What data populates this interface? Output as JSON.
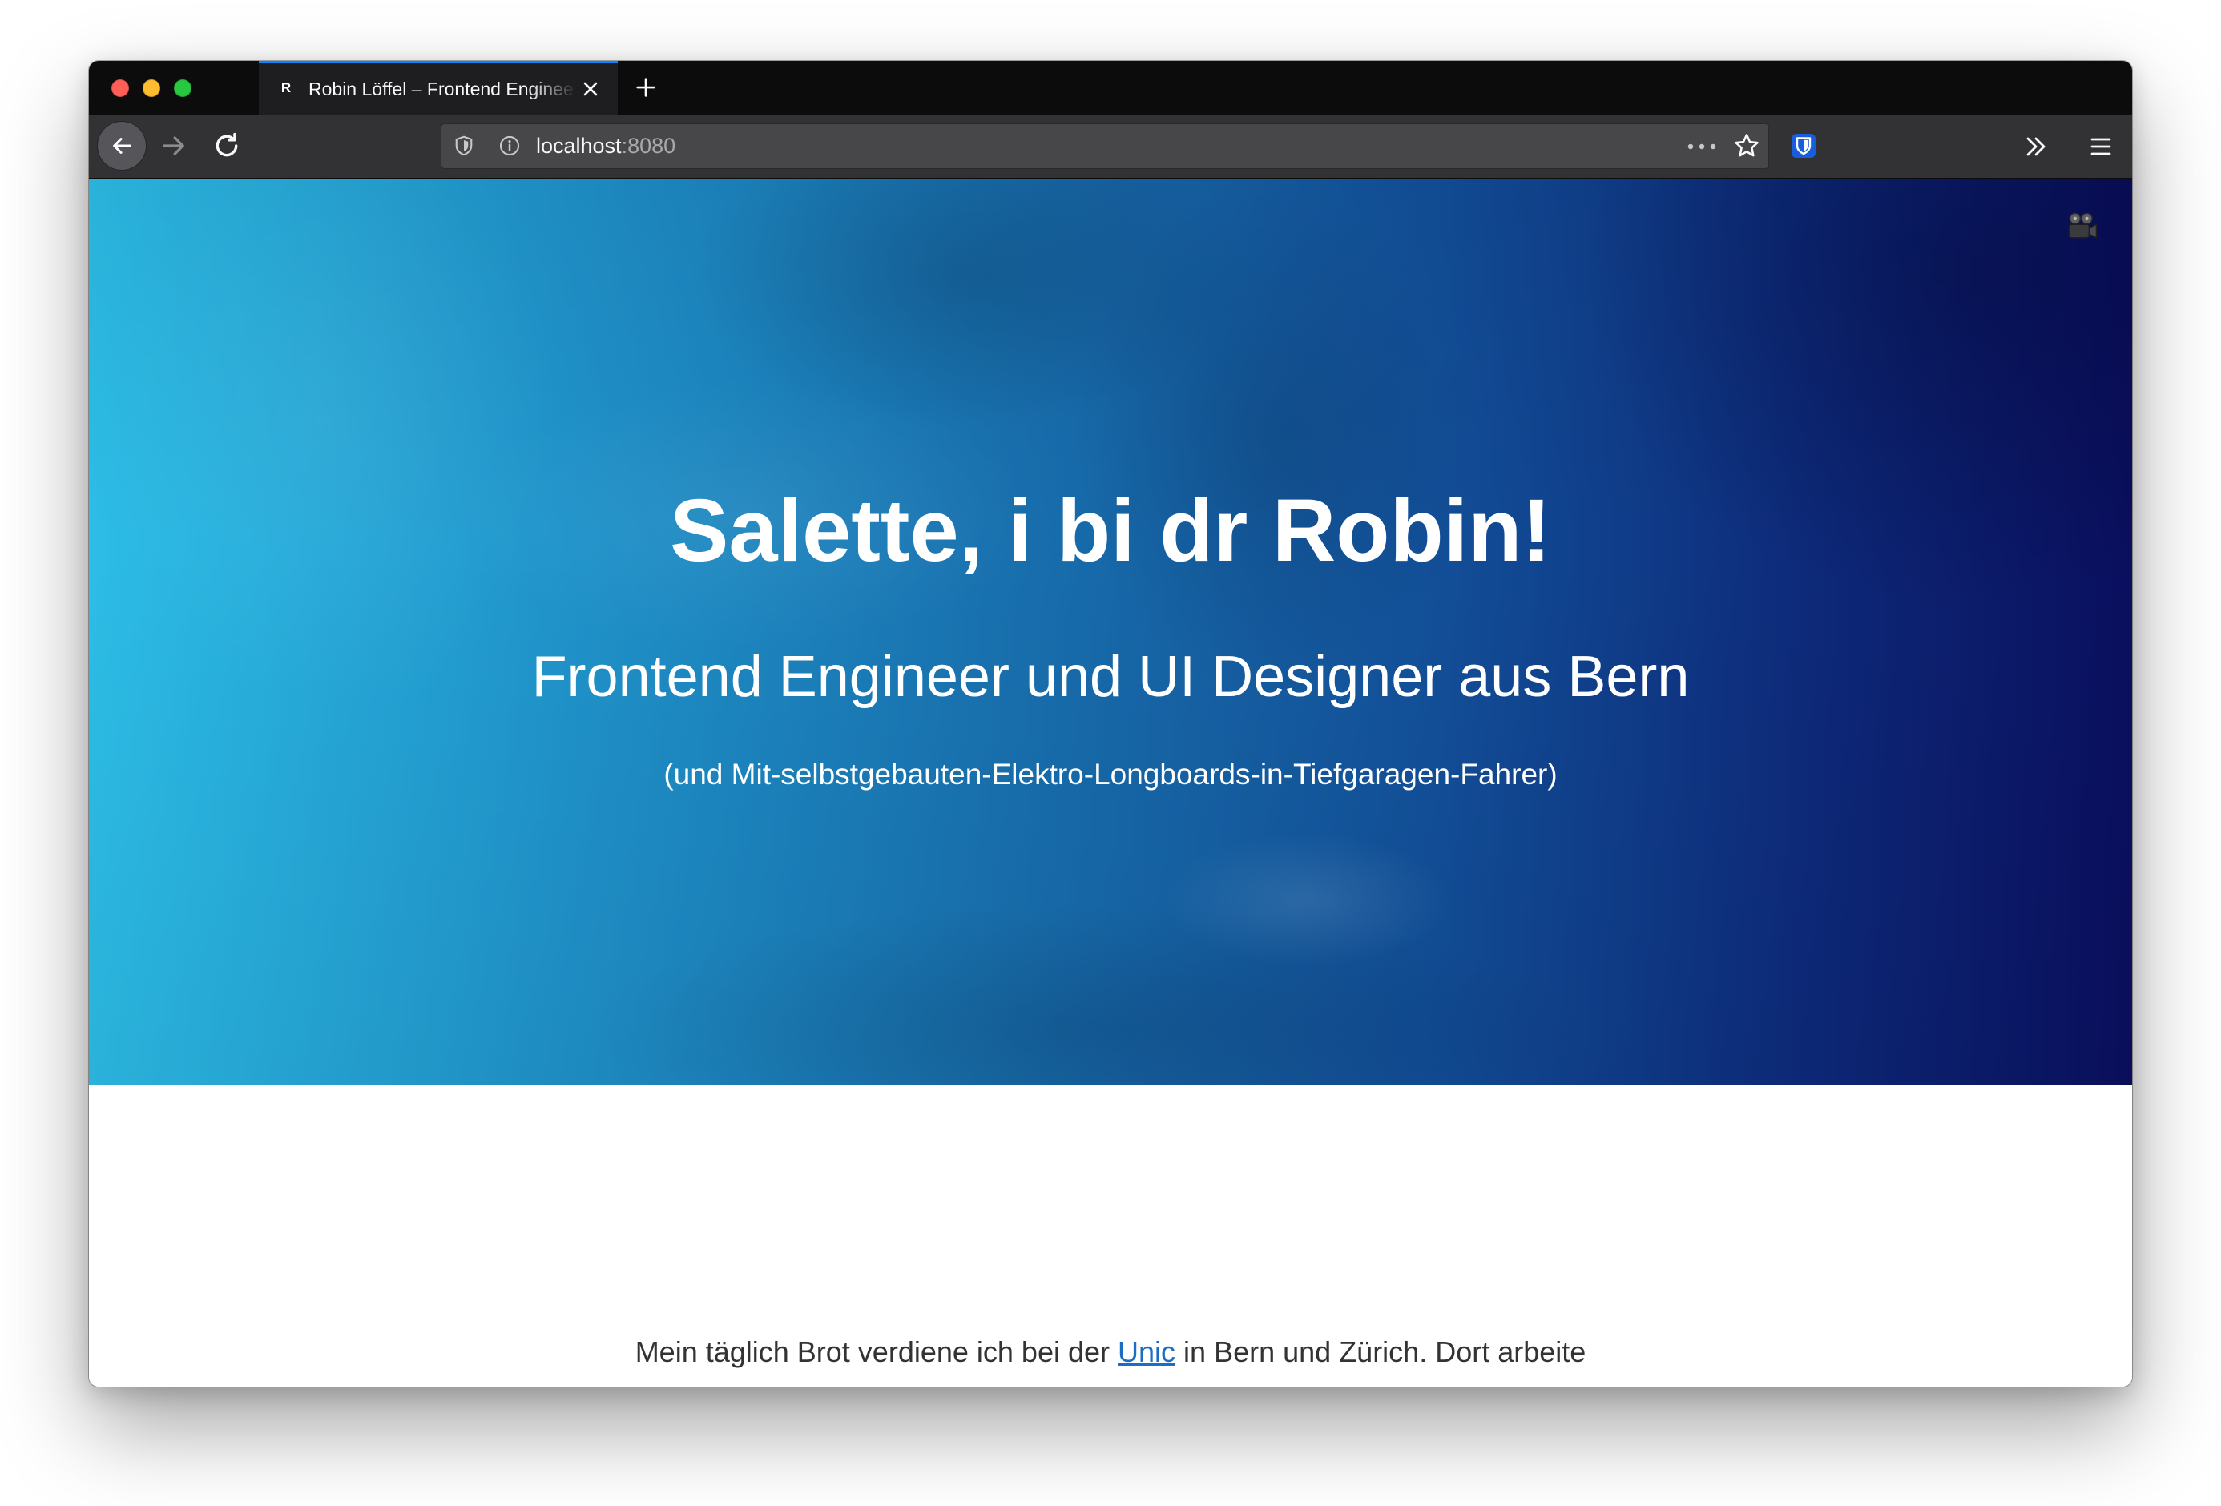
{
  "browser": {
    "window_controls": {
      "close_color": "#ff5f57",
      "minimize_color": "#febc2e",
      "zoom_color": "#28c840"
    },
    "colors": {
      "tab_strip": "#0c0c0d",
      "toolbar": "#323234",
      "url_bar": "#474749",
      "active_tab_accent": "#0a84ff"
    },
    "tab": {
      "favicon_letter": "R",
      "title": "Robin Löffel – Frontend Enginee",
      "close_icon": "close-icon"
    },
    "new_tab_icon": "plus-icon",
    "toolbar": {
      "back_icon": "arrow-left-icon",
      "forward_icon": "arrow-right-icon",
      "reload_icon": "reload-icon",
      "tracking_protection_icon": "shield-icon",
      "site_info_icon": "info-icon",
      "url_host": "localhost",
      "url_port": ":8080",
      "page_actions_icon": "ellipsis-icon",
      "bookmark_icon": "star-icon",
      "extension_icon": "bitwarden-icon",
      "overflow_icon": "double-chevron-right-icon",
      "menu_icon": "hamburger-menu-icon"
    }
  },
  "page": {
    "hero": {
      "heading": "Salette, i bi dr Robin!",
      "subheading": "Frontend Engineer und UI Designer aus Bern",
      "tagline": "(und Mit-selbstgebauten-Elektro-Longboards-in-Tiefgaragen-Fahrer)",
      "corner_icon": "video-camera-icon",
      "gradient_start": "#2cbde6",
      "gradient_end": "#0a0f5e"
    },
    "intro": {
      "text_before": "Mein täglich Brot verdiene ich bei der ",
      "link": "Unic",
      "text_after": " in Bern und Zürich. Dort arbeite",
      "text_color": "#333333",
      "link_color": "#1a6fc4"
    }
  }
}
